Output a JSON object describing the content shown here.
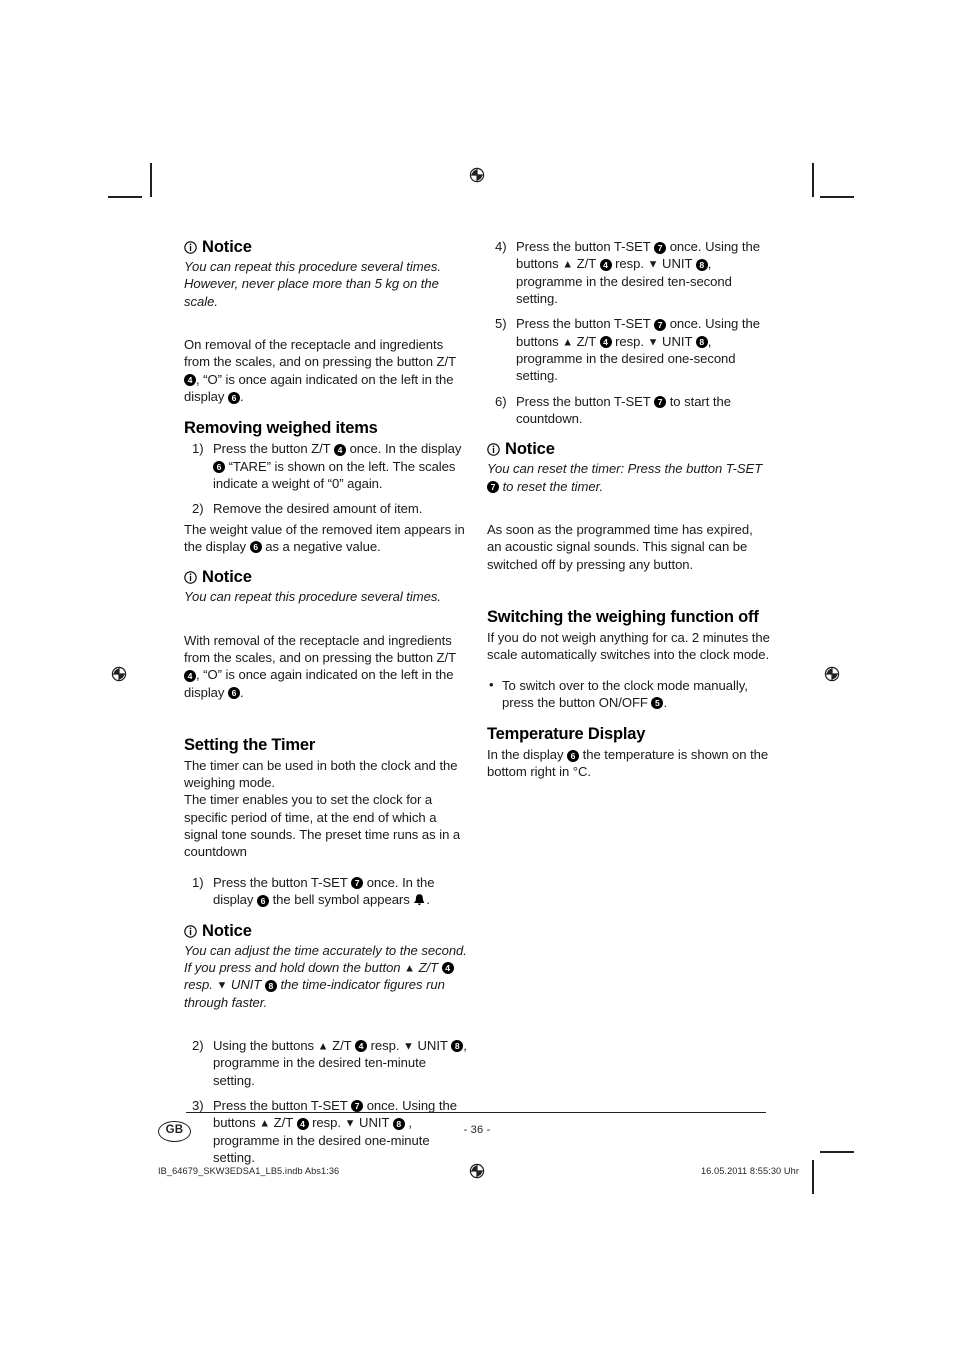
{
  "document": {
    "page_number": "- 36 -",
    "language_badge": "GB",
    "footer_left": "IB_64679_SKW3EDSA1_LB5.indb   Abs1:36",
    "footer_right": "16.05.2011   8:55:30 Uhr"
  },
  "left_column": {
    "notice_1": {
      "heading": "Notice",
      "body_line_1": "You can repeat this procedure several times.",
      "body_line_2": "However, never place more than 5 kg on the scale."
    },
    "para_removal": {
      "part_1": "On removal of the receptacle and ingredients from the scales, and on pressing the button Z/T ",
      "badge_1": "4",
      "part_2": ", “O” is once again indicated on the left in the display ",
      "badge_2": "6",
      "part_3": "."
    },
    "section_removing": {
      "heading": "Removing weighed items",
      "steps": [
        {
          "number": "1)",
          "part_1": "Press the button Z/T ",
          "badge_1": "4",
          "part_2": " once. In the display ",
          "badge_2": "6",
          "part_3": " “TARE” is shown on the left. The scales indicate a weight of “0” again."
        },
        {
          "number": "2)",
          "part_1": "Remove the desired amount of item.",
          "badge_1": "",
          "part_2": "",
          "badge_2": "",
          "part_3": ""
        }
      ],
      "after_part_1": "The weight value of the removed item appears in the display ",
      "after_badge": "6",
      "after_part_2": " as a negative value."
    },
    "notice_2": {
      "heading": "Notice",
      "body_line_1": "You can repeat this procedure several times."
    },
    "para_with_removal": {
      "part_1": "With removal of the receptacle and ingredients from the scales, and on pressing the button Z/T ",
      "badge_1": "4",
      "part_2": ", “O” is once again indicated on the left in the display ",
      "badge_2": "6",
      "part_3": "."
    },
    "section_timer": {
      "heading": "Setting the Timer",
      "para_1": "The timer can be used in both the clock and the weighing mode.",
      "para_2": "The timer enables you to set the clock for a specific period of time, at the end of which a signal tone sounds. The preset time runs as in a countdown",
      "step_1": {
        "number": "1)",
        "part_1": "Press the button T-SET ",
        "badge_1": "7",
        "part_2": " once. In the display ",
        "badge_2": "6",
        "part_3": " the bell symbol appears ",
        "bell_icon": "bell-icon",
        "part_4": "."
      }
    },
    "notice_3": {
      "heading": "Notice",
      "part_1": "You can adjust the time accurately to the second. If you press and hold down the button ",
      "arrow_up": "▲",
      "part_2": " Z/T ",
      "badge_1": "4",
      "part_3": " resp. ",
      "arrow_down": "▼",
      "part_4": " UNIT ",
      "badge_2": "8",
      "part_5": " the time-indicator figures run through faster."
    },
    "steps_timer": [
      {
        "number": "2)",
        "part_1": "Using the buttons ",
        "arrow_up": "▲",
        "part_2": " Z/T ",
        "badge_1": "4",
        "part_3": " resp. ",
        "arrow_down": "▼",
        "part_4": " UNIT ",
        "badge_2": "8",
        "part_5": ", programme in the desired ten-minute setting."
      },
      {
        "number": "3)",
        "part_1": "Press the button T-SET ",
        "badge_0": "7",
        "part_1b": " once. Using the buttons ",
        "arrow_up": "▲",
        "part_2": " Z/T ",
        "badge_1": "4",
        "part_3": " resp. ",
        "arrow_down": "▼",
        "part_4": " UNIT ",
        "badge_2": "8",
        "part_5": " , programme in the desired one-minute setting."
      }
    ]
  },
  "right_column": {
    "steps_timer": [
      {
        "number": "4)",
        "part_1": "Press the button T-SET ",
        "badge_0": "7",
        "part_1b": " once. Using the buttons ",
        "arrow_up": "▲",
        "part_2": " Z/T ",
        "badge_1": "4",
        "part_3": " resp. ",
        "arrow_down": "▼",
        "part_4": " UNIT ",
        "badge_2": "8",
        "part_5": ", programme in the desired ten-second setting."
      },
      {
        "number": "5)",
        "part_1": "Press the button T-SET ",
        "badge_0": "7",
        "part_1b": " once. Using the buttons ",
        "arrow_up": "▲",
        "part_2": " Z/T ",
        "badge_1": "4",
        "part_3": " resp. ",
        "arrow_down": "▼",
        "part_4": " UNIT ",
        "badge_2": "8",
        "part_5": ", programme in the desired one-second setting."
      },
      {
        "number": "6)",
        "part_1": "Press the button T-SET ",
        "badge_0": "7",
        "part_1b": " to start the countdown.",
        "arrow_up": "",
        "part_2": "",
        "badge_1": "",
        "part_3": "",
        "arrow_down": "",
        "part_4": "",
        "badge_2": "",
        "part_5": ""
      }
    ],
    "notice_1": {
      "heading": "Notice",
      "part_1": "You can reset the timer: Press the button T-SET ",
      "badge_1": "7",
      "part_2": " to reset the timer."
    },
    "para_expired": "As soon as the programmed time has expired, an acoustic signal sounds. This signal can be switched off by pressing any button.",
    "section_switching": {
      "heading": "Switching the weighing function off",
      "para_1": "If you do not weigh anything for ca. 2 minutes the scale automatically switches into the clock mode.",
      "bullet": {
        "part_1": "To switch over to the clock mode manually, press the button ON/OFF ",
        "badge_1": "5",
        "part_2": "."
      }
    },
    "section_temperature": {
      "heading": "Temperature Display",
      "part_1": "In the display ",
      "badge_1": "6",
      "part_2": " the temperature is shown on the bottom right in °C."
    }
  }
}
